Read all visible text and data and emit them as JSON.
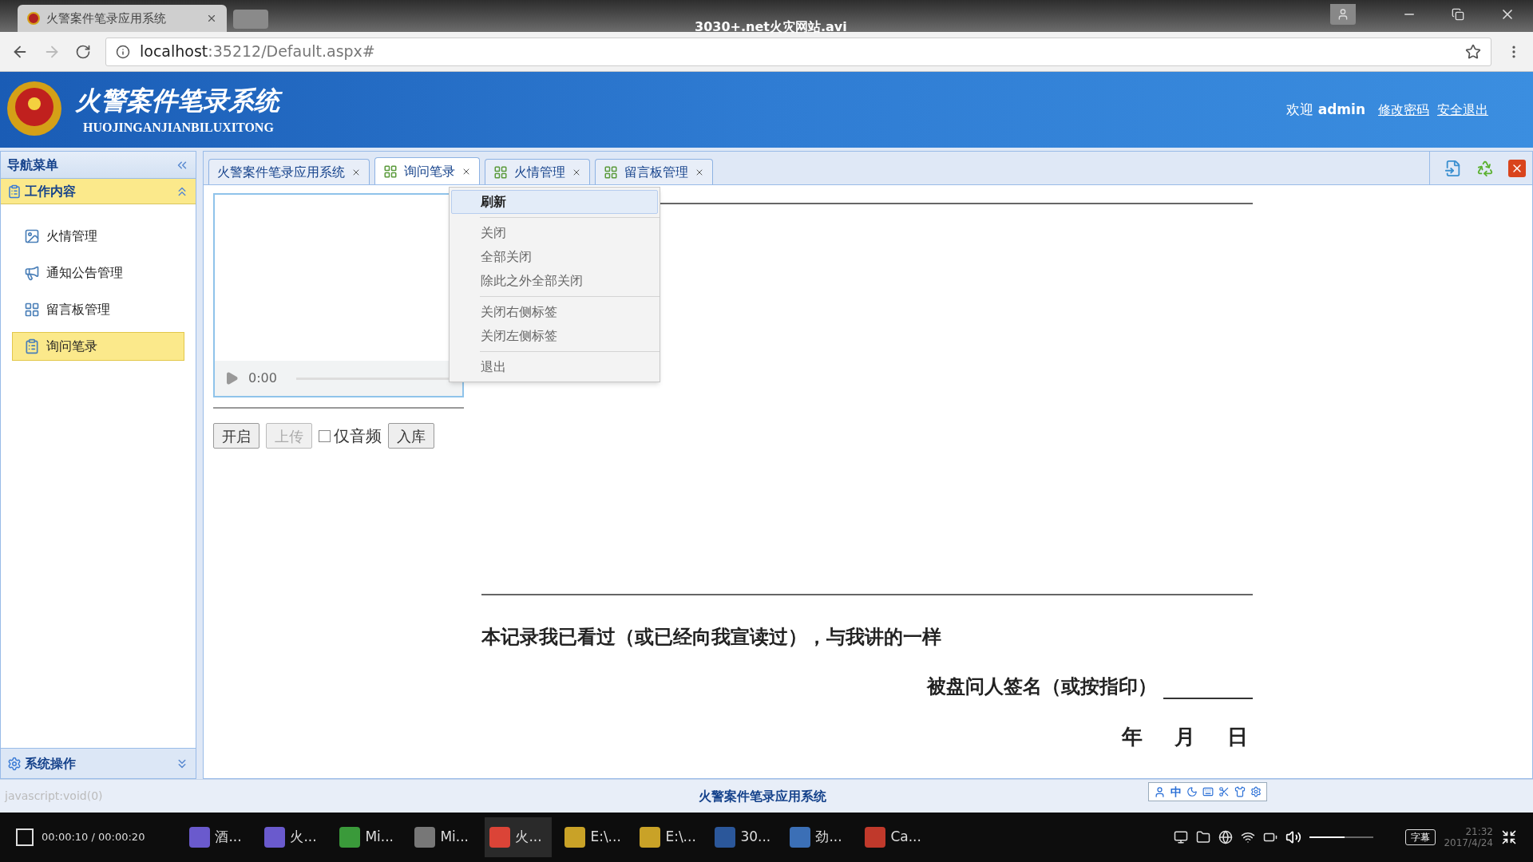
{
  "video_player": {
    "title": "3030+.net火灾网站.avi",
    "time": "00:00:10 / 00:00:20",
    "subtitle_button": "字幕",
    "volume": {
      "level": 0.55
    }
  },
  "browser": {
    "tab_title": "火警案件笔录应用系统",
    "url_host": "localhost",
    "url_rest": ":35212/Default.aspx#"
  },
  "header": {
    "title": "火警案件笔录系统",
    "subtitle": "HUOJINGANJIANBILUXITONG",
    "welcome": "欢迎",
    "user": "admin",
    "links": [
      "修改密码",
      "安全退出"
    ]
  },
  "sidebar": {
    "title": "导航菜单",
    "sections": [
      {
        "label": "工作内容",
        "expanded": true,
        "items": [
          {
            "label": "火情管理",
            "selected": false
          },
          {
            "label": "通知公告管理",
            "selected": false
          },
          {
            "label": "留言板管理",
            "selected": false
          },
          {
            "label": "询问笔录",
            "selected": true
          }
        ]
      },
      {
        "label": "系统操作",
        "expanded": false
      }
    ]
  },
  "tabs": [
    {
      "label": "火警案件笔录应用系统",
      "selected": false
    },
    {
      "label": "询问笔录",
      "selected": true
    },
    {
      "label": "火情管理",
      "selected": false
    },
    {
      "label": "留言板管理",
      "selected": false
    }
  ],
  "context_menu": [
    {
      "kind": "item",
      "label": "刷新",
      "selected": true
    },
    {
      "kind": "separator"
    },
    {
      "kind": "item",
      "label": "关闭",
      "selected": false
    },
    {
      "kind": "item",
      "label": "全部关闭",
      "selected": false
    },
    {
      "kind": "item",
      "label": "除此之外全部关闭",
      "selected": false
    },
    {
      "kind": "separator"
    },
    {
      "kind": "item",
      "label": "关闭右侧标签",
      "selected": false
    },
    {
      "kind": "item",
      "label": "关闭左侧标签",
      "selected": false
    },
    {
      "kind": "separator"
    },
    {
      "kind": "item",
      "label": "退出",
      "selected": false
    }
  ],
  "form": {
    "audio_time": "0:00",
    "buttons": [
      {
        "label": "开启",
        "disabled": false
      },
      {
        "label": "上传",
        "disabled": true
      }
    ],
    "checkbox": {
      "label": "仅音频",
      "checked": false
    },
    "save_button": "入库",
    "statement": "本记录我已看过（或已经向我宣读过），与我讲的一样",
    "signature_label": "被盘问人签名（或按指印）",
    "date": [
      "年",
      "月",
      "日"
    ]
  },
  "status_bar": {
    "left": "javascript:void(0)",
    "center": "火警案件笔录应用系统"
  },
  "ime_toolbar": {
    "mode": "中"
  },
  "taskbar": {
    "items": [
      "酒...",
      "火...",
      "Mi...",
      "Mi...",
      "火...",
      "E:\\...",
      "E:\\...",
      "30...",
      "劲...",
      "Ca..."
    ],
    "time": "21:32",
    "date": "2017/4/24"
  }
}
